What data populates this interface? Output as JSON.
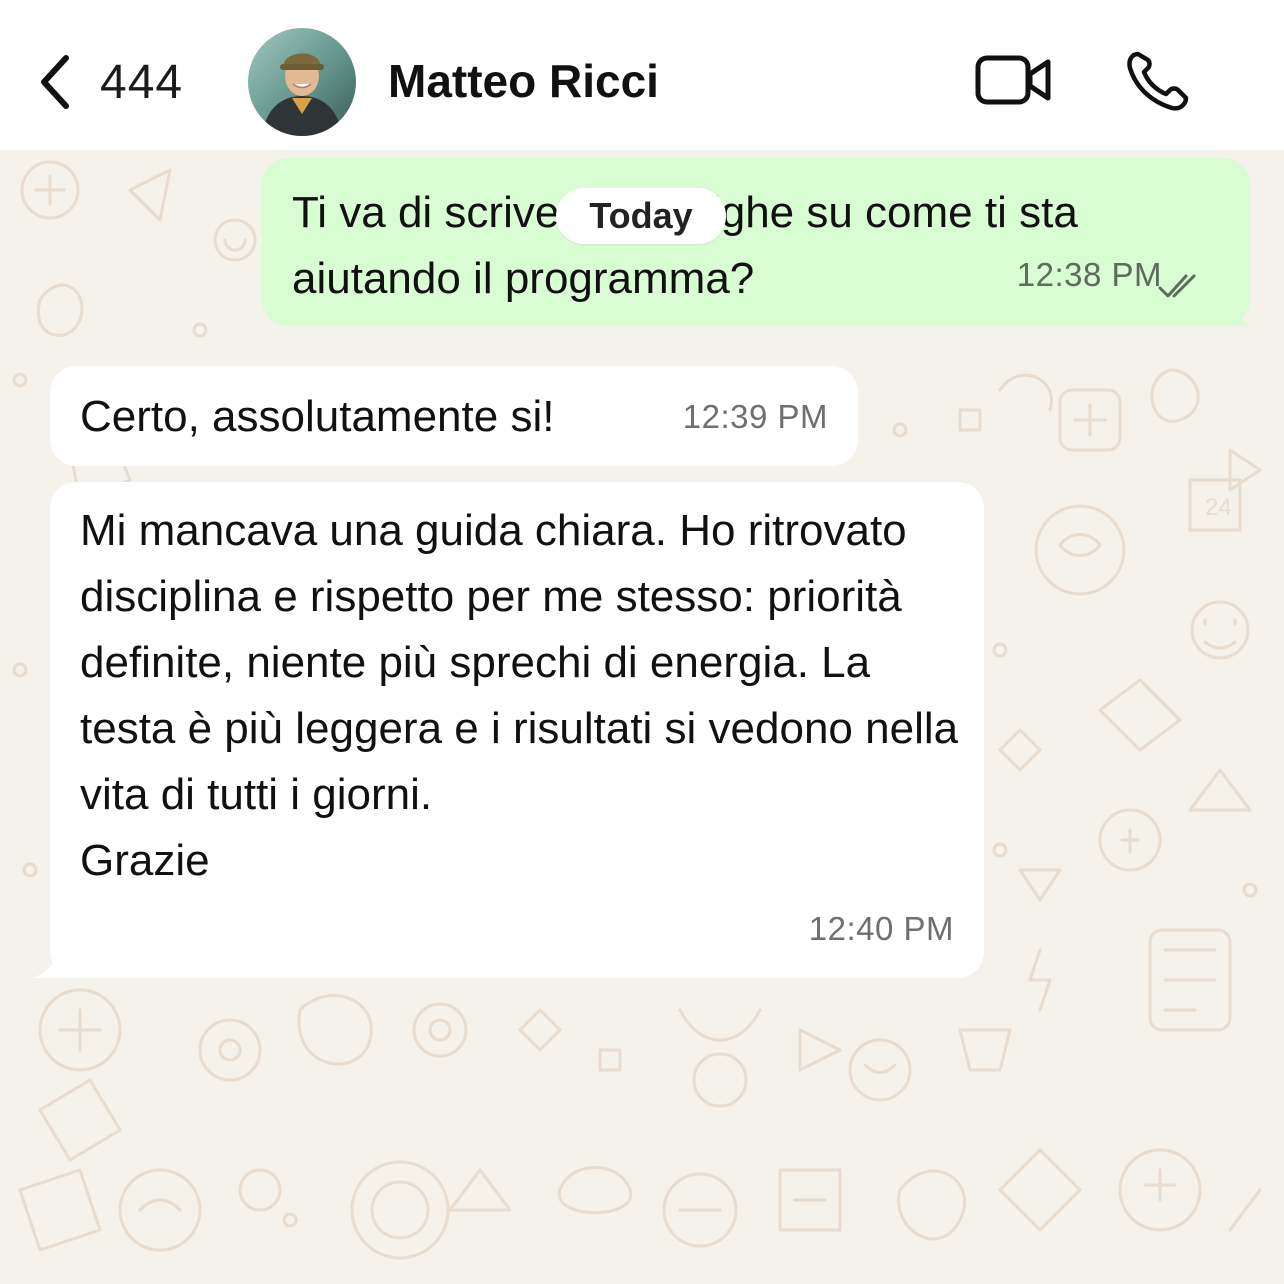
{
  "header": {
    "back_count": "444",
    "contact_name": "Matteo Ricci",
    "icons": [
      "chevron-left-icon",
      "avatar",
      "video-camera-icon",
      "phone-icon"
    ]
  },
  "chat": {
    "date_chip": "Today",
    "messages": [
      {
        "direction": "outgoing",
        "text": "Ti va di scrivere due righe su come ti sta aiutando il programma?",
        "time": "12:38 PM",
        "status": "read"
      },
      {
        "direction": "incoming",
        "text": "Certo, assolutamente si!",
        "time": "12:39 PM"
      },
      {
        "direction": "incoming",
        "text": "Mi mancava una guida chiara. Ho ritrovato disciplina e rispetto per me stesso: priorità definite, niente più sprechi di energia. La testa è più leggera e i risultati si vedono nella vita di tutti i giorni.\nGrazie",
        "time": "12:40 PM"
      }
    ]
  },
  "colors": {
    "outgoing_bubble": "#d9fdd3",
    "incoming_bubble": "#ffffff",
    "wallpaper": "#f5f1eb",
    "doodle": "#e8ddd0"
  }
}
